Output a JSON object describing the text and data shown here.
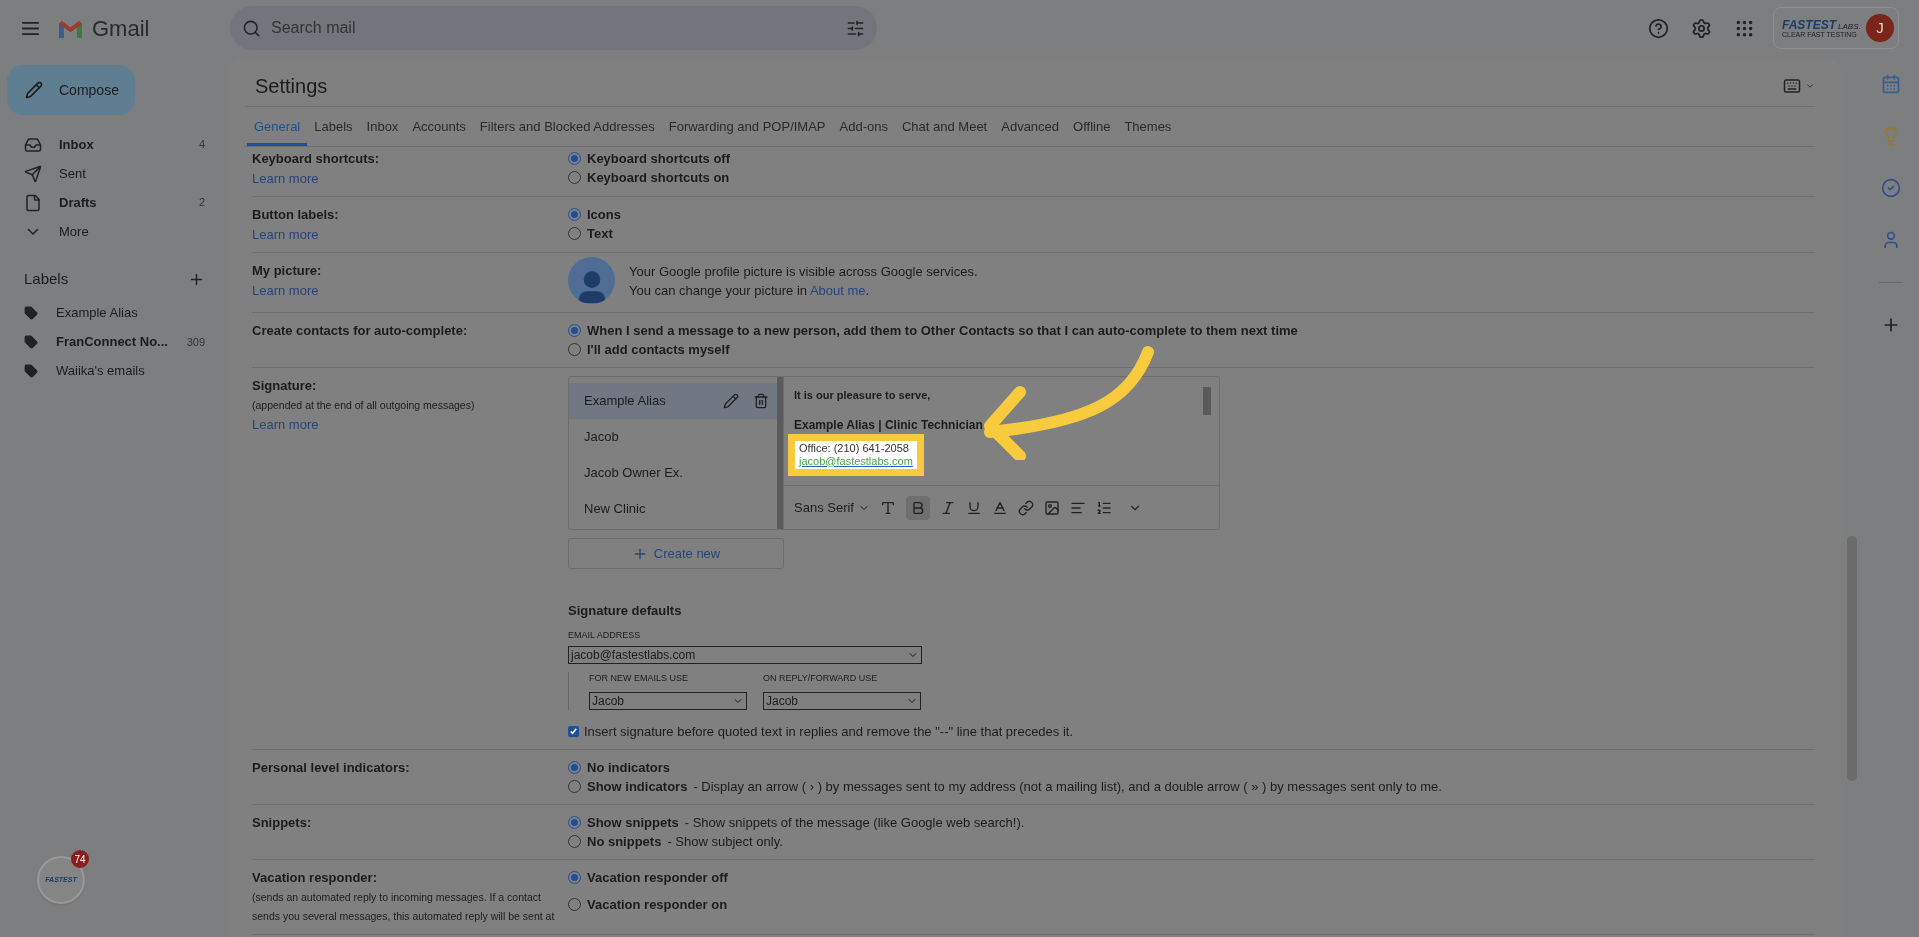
{
  "app": {
    "name": "Gmail"
  },
  "sidebar": {
    "compose": "Compose",
    "items": [
      {
        "label": "Inbox",
        "count": "4",
        "bold": true
      },
      {
        "label": "Sent",
        "bold": false
      },
      {
        "label": "Drafts",
        "count": "2",
        "bold": true
      },
      {
        "label": "More",
        "bold": false
      }
    ],
    "labels_title": "Labels",
    "labels": [
      {
        "label": "Example Alias",
        "bold": false
      },
      {
        "label": "FranConnect No...",
        "count": "309",
        "bold": true
      },
      {
        "label": "Waiika's emails",
        "bold": false
      }
    ]
  },
  "search": {
    "placeholder": "Search mail"
  },
  "account": {
    "logo_text": "FASTEST",
    "logo_suffix": "LABS.",
    "logo_tagline": "CLEAR FAST TESTING",
    "avatar": "J"
  },
  "settings": {
    "title": "Settings",
    "tabs": [
      {
        "label": "General",
        "selected": true
      },
      {
        "label": "Labels",
        "selected": false
      },
      {
        "label": "Inbox",
        "selected": false
      },
      {
        "label": "Accounts",
        "selected": false
      },
      {
        "label": "Filters and Blocked Addresses",
        "selected": false
      },
      {
        "label": "Forwarding and POP/IMAP",
        "selected": false
      },
      {
        "label": "Add-ons",
        "selected": false
      },
      {
        "label": "Chat and Meet",
        "selected": false
      },
      {
        "label": "Advanced",
        "selected": false
      },
      {
        "label": "Offline",
        "selected": false
      },
      {
        "label": "Themes",
        "selected": false
      }
    ],
    "rows": [
      {
        "kind": "radio",
        "label": "Keyboard shortcuts:",
        "link": "Learn more",
        "options": [
          {
            "label": "Keyboard shortcuts off",
            "selected": true
          },
          {
            "label": "Keyboard shortcuts on",
            "selected": false
          }
        ]
      },
      {
        "kind": "radio",
        "label": "Button labels:",
        "link": "Learn more",
        "options": [
          {
            "label": "Icons",
            "selected": true
          },
          {
            "label": "Text",
            "selected": false
          }
        ]
      },
      {
        "kind": "picture",
        "label": "My picture:",
        "link": "Learn more",
        "line1": "Your Google profile picture is visible across Google services.",
        "line2": "You can change your picture in",
        "line2_link": "About me",
        "line2_end": "."
      },
      {
        "kind": "radio",
        "label": "Create contacts for auto-complete:",
        "options": [
          {
            "label": "When I send a message to a new person, add them to Other Contacts so that I can auto-complete to them next time",
            "selected": true
          },
          {
            "label": "I'll add contacts myself",
            "selected": false
          }
        ]
      },
      {
        "kind": "signature",
        "label": "Signature:",
        "note": "(appended at the end of all outgoing messages)",
        "link": "Learn more"
      },
      {
        "kind": "radio",
        "label": "Personal level indicators:",
        "options": [
          {
            "label": "No indicators",
            "selected": true
          },
          {
            "label": "Show indicators",
            "desc": "- Display an arrow ( › ) by messages sent to my address (not a mailing list), and a double arrow ( » ) by messages sent only to me.",
            "selected": false
          }
        ]
      },
      {
        "kind": "radio",
        "label": "Snippets:",
        "options": [
          {
            "label": "Show snippets",
            "desc": "- Show snippets of the message (like Google web search!).",
            "selected": true
          },
          {
            "label": "No snippets",
            "desc": "- Show subject only.",
            "selected": false
          }
        ]
      },
      {
        "kind": "radio",
        "label": "Vacation responder:",
        "note": "(sends an automated reply to incoming messages. If a contact sends you several messages, this automated reply will be sent at",
        "options": [
          {
            "label": "Vacation responder off",
            "selected": true
          },
          {
            "label": "Vacation responder on",
            "selected": false
          }
        ]
      }
    ]
  },
  "signature": {
    "list": [
      {
        "name": "Example Alias",
        "selected": true
      },
      {
        "name": "Jacob",
        "selected": false
      },
      {
        "name": "Jacob Owner Ex.",
        "selected": false
      },
      {
        "name": "New Clinic",
        "selected": false
      }
    ],
    "body": {
      "greeting": "It is our pleasure to serve,",
      "name_line": "Example Alias | Clinic Technician",
      "office": "Office: (210) 641-2058",
      "email": "jacob@fastestlabs.com"
    },
    "font": "Sans Serif",
    "create_new": "Create new",
    "defaults": {
      "title": "Signature defaults",
      "email_label": "EMAIL ADDRESS",
      "email": "jacob@fastestlabs.com",
      "new_label": "FOR NEW EMAILS USE",
      "new_value": "Jacob",
      "reply_label": "ON REPLY/FORWARD USE",
      "reply_value": "Jacob"
    },
    "insert": {
      "label": "Insert signature before quoted text in replies and remove the \"--\" line that precedes it.",
      "checked": true
    }
  },
  "badge": {
    "count": "74",
    "logo_text": "FASTEST"
  }
}
